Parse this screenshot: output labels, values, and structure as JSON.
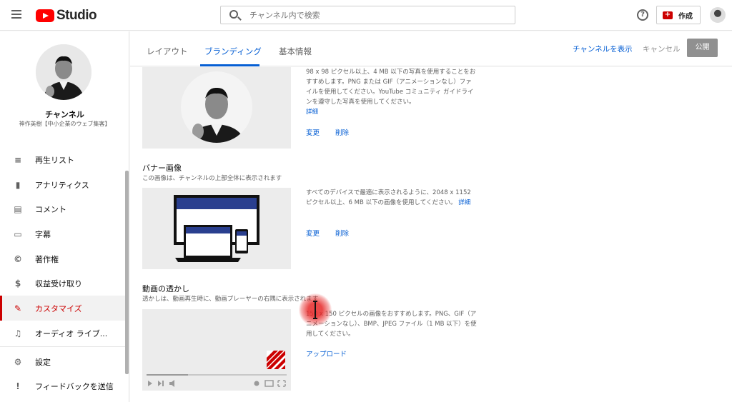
{
  "header": {
    "logo_text": "Studio",
    "search_placeholder": "チャンネル内で検索",
    "help_glyph": "?",
    "create_label": "作成"
  },
  "sidebar": {
    "channel_title": "チャンネル",
    "channel_name": "神作英樹【中小企業のウェブ集客】",
    "items": [
      {
        "label": "再生リスト",
        "icon": "playlist-icon"
      },
      {
        "label": "アナリティクス",
        "icon": "analytics-icon"
      },
      {
        "label": "コメント",
        "icon": "comment-icon"
      },
      {
        "label": "字幕",
        "icon": "subtitles-icon"
      },
      {
        "label": "著作権",
        "icon": "copyright-icon"
      },
      {
        "label": "収益受け取り",
        "icon": "dollar-icon"
      },
      {
        "label": "カスタマイズ",
        "icon": "magic-wand-icon",
        "active": true
      },
      {
        "label": "オーディオ ライブ...",
        "icon": "audio-library-icon"
      }
    ],
    "footer_items": [
      {
        "label": "設定",
        "icon": "gear-icon"
      },
      {
        "label": "フィードバックを送信",
        "icon": "feedback-icon"
      }
    ]
  },
  "tabs": [
    {
      "label": "レイアウト"
    },
    {
      "label": "ブランディング",
      "active": true
    },
    {
      "label": "基本情報"
    }
  ],
  "actions": {
    "view_channel": "チャンネルを表示",
    "cancel": "キャンセル",
    "publish": "公開"
  },
  "profile_section": {
    "desc": "98 x 98 ピクセル以上、4 MB 以下の写真を使用することをおすすめします。PNG または GIF（アニメーションなし）ファイルを使用してください。YouTube コミュニティ ガイドラインを遵守した写真を使用してください。",
    "details_link": "詳細",
    "change": "変更",
    "delete": "削除"
  },
  "banner_section": {
    "title": "バナー画像",
    "subtitle": "この画像は、チャンネルの上部全体に表示されます",
    "desc": "すべてのデバイスで最適に表示されるように、2048 x 1152 ピクセル以上、6 MB 以下の画像を使用してください。",
    "details_link": "詳細",
    "change": "変更",
    "delete": "削除"
  },
  "watermark_section": {
    "title": "動画の透かし",
    "subtitle": "透かしは、動画再生時に、動画プレーヤーの右隅に表示されます",
    "desc": "150 x 150 ピクセルの画像をおすすめします。PNG、GIF（アニメーションなし）、BMP、JPEG ファイル（1 MB 以下）を使用してください。",
    "upload": "アップロード"
  },
  "colors": {
    "accent": "#065fd4",
    "brand_red": "#cc0000"
  }
}
